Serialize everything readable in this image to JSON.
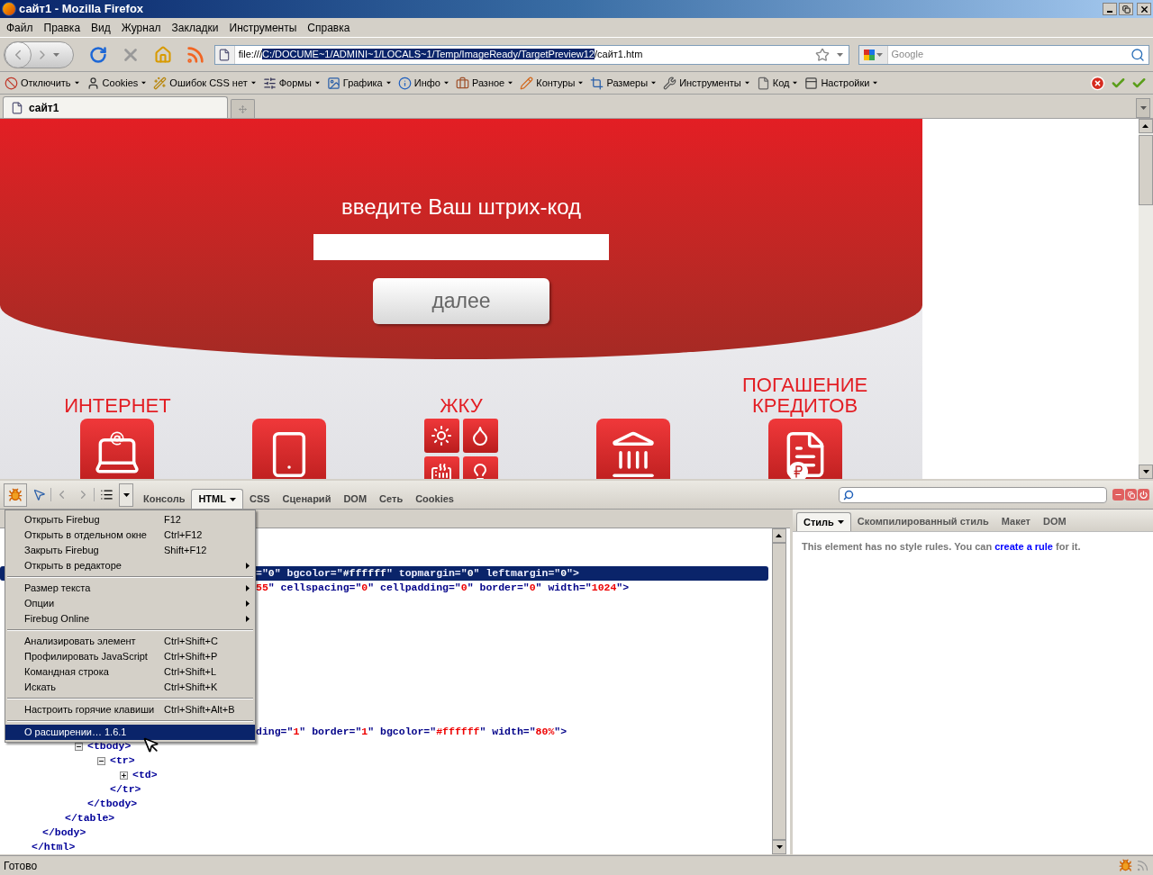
{
  "window": {
    "title": "сайт1 - Mozilla Firefox"
  },
  "menu_bar": [
    "Файл",
    "Правка",
    "Вид",
    "Журнал",
    "Закладки",
    "Инструменты",
    "Справка"
  ],
  "address_bar": {
    "prefix": "file:///",
    "selected_text": "C:/DOCUME~1/ADMINI~1/LOCALS~1/Temp/ImageReady/TargetPreview12",
    "suffix": "/сайт1.htm"
  },
  "search_bar": {
    "placeholder": "Google"
  },
  "dev_toolbar": [
    "Отключить",
    "Cookies",
    "Ошибок CSS нет",
    "Формы",
    "Графика",
    "Инфо",
    "Разное",
    "Контуры",
    "Размеры",
    "Инструменты",
    "Код",
    "Настройки"
  ],
  "tabs": [
    {
      "label": "сайт1",
      "selected": true
    }
  ],
  "page": {
    "heading": "введите Ваш штрих-код",
    "button": "далее",
    "categories": [
      {
        "kind": "internet",
        "label": "ИНТЕРНЕТ"
      },
      {
        "kind": "phone"
      },
      {
        "kind": "utilities",
        "label": "ЖКУ"
      },
      {
        "kind": "bank"
      },
      {
        "kind": "credit",
        "label": "ПОГАШЕНИЕ КРЕДИТОВ"
      }
    ]
  },
  "firebug": {
    "tabs": [
      {
        "label": "Консоль",
        "selected": false,
        "dropdown": false
      },
      {
        "label": "HTML",
        "selected": true,
        "dropdown": true
      },
      {
        "label": "CSS",
        "selected": false,
        "dropdown": false
      },
      {
        "label": "Сценарий",
        "selected": false,
        "dropdown": false
      },
      {
        "label": "DOM",
        "selected": false,
        "dropdown": false
      },
      {
        "label": "Сеть",
        "selected": false,
        "dropdown": false
      },
      {
        "label": "Cookies",
        "selected": false,
        "dropdown": false
      }
    ],
    "menu": [
      {
        "kind": "item",
        "label": "Открыть Firebug",
        "shortcut": "F12",
        "selected": false
      },
      {
        "kind": "item",
        "label": "Открыть в отдельном окне",
        "shortcut": "Ctrl+F12",
        "selected": false
      },
      {
        "kind": "item",
        "label": "Закрыть Firebug",
        "shortcut": "Shift+F12",
        "selected": false
      },
      {
        "kind": "submenu",
        "label": "Открыть в редакторе",
        "selected": false
      },
      {
        "kind": "separator"
      },
      {
        "kind": "submenu",
        "label": "Размер текста",
        "selected": false
      },
      {
        "kind": "submenu",
        "label": "Опции",
        "selected": false
      },
      {
        "kind": "submenu",
        "label": "Firebug Online",
        "selected": false
      },
      {
        "kind": "separator"
      },
      {
        "kind": "item",
        "label": "Анализировать элемент",
        "shortcut": "Ctrl+Shift+C",
        "selected": false
      },
      {
        "kind": "item",
        "label": "Профилировать JavaScript",
        "shortcut": "Ctrl+Shift+P",
        "selected": false
      },
      {
        "kind": "item",
        "label": "Командная строка",
        "shortcut": "Ctrl+Shift+L",
        "selected": false
      },
      {
        "kind": "item",
        "label": "Искать",
        "shortcut": "Ctrl+Shift+K",
        "selected": false
      },
      {
        "kind": "separator"
      },
      {
        "kind": "item",
        "label": "Настроить горячие клавиши",
        "shortcut": "Ctrl+Shift+Alt+B",
        "selected": false
      },
      {
        "kind": "separator"
      },
      {
        "kind": "item",
        "label": "О расширении… 1.6.1",
        "selected": true
      }
    ],
    "html_tree": {
      "close": "</html>",
      "children": [
        {
          "partial": true,
          "selected": true,
          "close": "</body>",
          "open": [
            {
              "text": "=\"",
              "kind": "markup"
            },
            {
              "text": "0",
              "kind": "value"
            },
            {
              "text": "\" bgcolor=\"",
              "kind": "markup"
            },
            {
              "text": "#ffffff",
              "kind": "value"
            },
            {
              "text": "\" topmargin=\"",
              "kind": "markup"
            },
            {
              "text": "0",
              "kind": "value"
            },
            {
              "text": "\" leftmargin=\"",
              "kind": "markup"
            },
            {
              "text": "0",
              "kind": "value"
            },
            {
              "text": "\">",
              "kind": "markup"
            }
          ],
          "children": [
            {
              "partial": true,
              "selected": false,
              "children_hidden": true,
              "open": [
                {
                  "text": "55",
                  "kind": "value"
                },
                {
                  "text": "\" cellspacing=\"",
                  "kind": "markup"
                },
                {
                  "text": "0",
                  "kind": "value"
                },
                {
                  "text": "\" cellpadding=\"",
                  "kind": "markup"
                },
                {
                  "text": "0",
                  "kind": "value"
                },
                {
                  "text": "\" border=\"",
                  "kind": "markup"
                },
                {
                  "text": "0",
                  "kind": "value"
                },
                {
                  "text": "\" width=\"",
                  "kind": "markup"
                },
                {
                  "text": "1024",
                  "kind": "value"
                },
                {
                  "text": "\">",
                  "kind": "markup"
                }
              ]
            },
            {
              "partial": true,
              "selected": false,
              "close": "</table>",
              "open": [
                {
                  "text": "ding=\"",
                  "kind": "markup"
                },
                {
                  "text": "1",
                  "kind": "value"
                },
                {
                  "text": "\" border=\"",
                  "kind": "markup"
                },
                {
                  "text": "1",
                  "kind": "value"
                },
                {
                  "text": "\" bgcolor=\"",
                  "kind": "markup"
                },
                {
                  "text": "#ffffff",
                  "kind": "value"
                },
                {
                  "text": "\" width=\"",
                  "kind": "markup"
                },
                {
                  "text": "80%",
                  "kind": "value"
                },
                {
                  "text": "\">",
                  "kind": "markup"
                }
              ],
              "children": [
                {
                  "open_text": "<tbody>",
                  "expanded": true,
                  "selected": false,
                  "close": "</tbody>",
                  "children": [
                    {
                      "open_text": "<tr>",
                      "expanded": true,
                      "selected": false,
                      "close": "</tr>",
                      "children": [
                        {
                          "open_text": "<td>",
                          "expanded": false,
                          "selected": false
                        }
                      ]
                    }
                  ]
                }
              ]
            }
          ]
        }
      ]
    },
    "side_tabs": [
      {
        "label": "Стиль",
        "selected": true,
        "dropdown": true
      },
      {
        "label": "Скомпилированный стиль",
        "selected": false,
        "dropdown": false
      },
      {
        "label": "Макет",
        "selected": false,
        "dropdown": false
      },
      {
        "label": "DOM",
        "selected": false,
        "dropdown": false
      }
    ],
    "style_message": {
      "before": "This element has no style rules. You can ",
      "link": "create a rule",
      "after": " for it."
    }
  },
  "status_bar": {
    "text": "Готово"
  }
}
